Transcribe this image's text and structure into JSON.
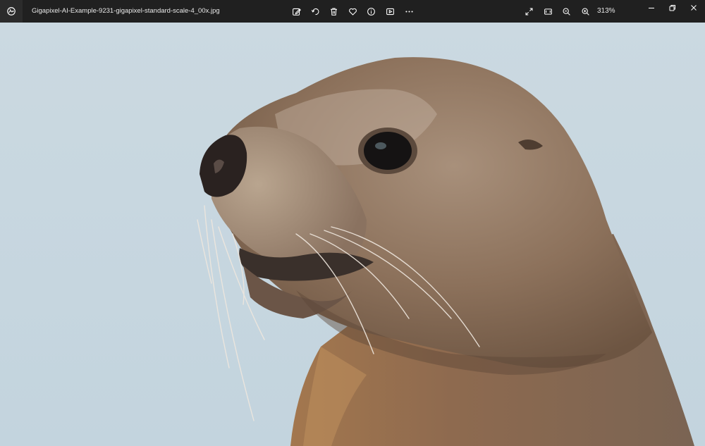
{
  "window": {
    "filename": "Gigapixel-AI-Example-9231-gigapixel-standard-scale-4_00x.jpg",
    "zoom_level": "313%"
  },
  "toolbar": {
    "actions": [
      {
        "name": "edit-image-icon"
      },
      {
        "name": "rotate-icon"
      },
      {
        "name": "delete-icon"
      },
      {
        "name": "favorite-heart-icon"
      },
      {
        "name": "info-icon"
      },
      {
        "name": "slideshow-icon"
      },
      {
        "name": "more-options-icon"
      }
    ],
    "view_actions": [
      {
        "name": "fullscreen-icon"
      },
      {
        "name": "fit-to-window-icon"
      },
      {
        "name": "zoom-out-icon"
      },
      {
        "name": "zoom-in-icon"
      }
    ]
  },
  "window_controls": [
    {
      "name": "minimize-icon"
    },
    {
      "name": "restore-icon"
    },
    {
      "name": "close-icon"
    }
  ],
  "colors": {
    "titlebar": "#202020",
    "sky": "#c9d8e0",
    "fur": "#8b6e56",
    "fur_light": "#b59a82"
  }
}
